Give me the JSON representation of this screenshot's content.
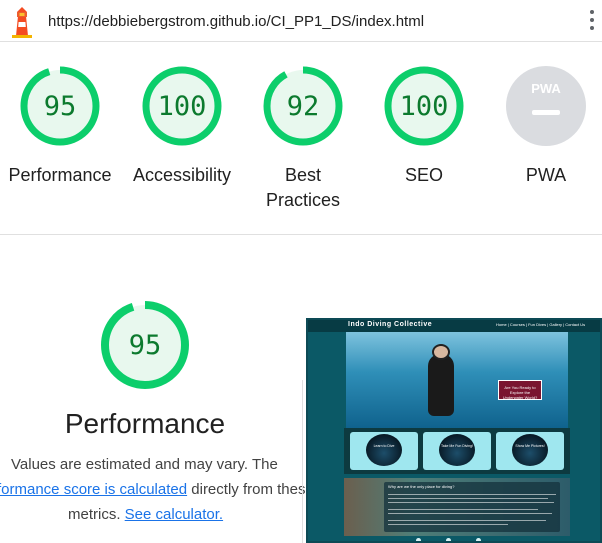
{
  "url_bar": {
    "logo_icon": "lighthouse-icon",
    "url": "https://debbiebergstrom.github.io/CI_PP1_DS/index.html",
    "menu_icon": "kebab-menu-icon"
  },
  "gauges": [
    {
      "score": "95",
      "label": "Performance",
      "fraction": 0.95
    },
    {
      "score": "100",
      "label": "Accessibility",
      "fraction": 1.0
    },
    {
      "score": "92",
      "label_line1": "Best",
      "label_line2": "Practices",
      "fraction": 0.92
    },
    {
      "score": "100",
      "label": "SEO",
      "fraction": 1.0
    },
    {
      "badge": "PWA",
      "label": "PWA"
    }
  ],
  "colors": {
    "pass": "#0cce6b",
    "pass_text": "#0c7a2e",
    "pass_fill": "#e8f8ee",
    "na_gray": "#dadce0",
    "link": "#1a73e8"
  },
  "performance": {
    "score": "95",
    "fraction": 0.95,
    "title": "Performance",
    "line1": "Values are estimated and may vary. The",
    "line2_link": "formance score is calculated",
    "line2_rest": "directly from these",
    "line3_text": "metrics.",
    "line3_link": "See calculator."
  },
  "screenshot": {
    "brand": "Indo Diving Collective",
    "nav_links": "Home | Courses | Fun Dives | Gallery | Contact Us",
    "cta": "Are You Ready to Explore the Underwater World?",
    "cards": [
      "Learn to Dive",
      "Take Me Fun Diving!",
      "Show Me Pictures!"
    ],
    "text_heading": "Why are we the only place for diving?"
  }
}
